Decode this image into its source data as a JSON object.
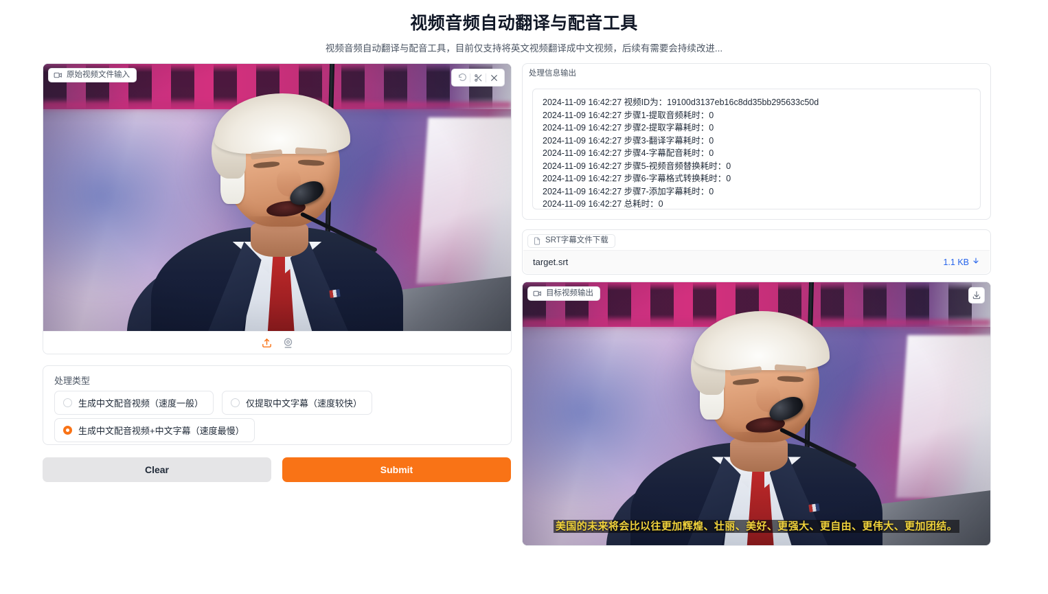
{
  "header": {
    "title": "视频音频自动翻译与配音工具",
    "subtitle": "视频音频自动翻译与配音工具，目前仅支持将英文视频翻译成中文视频，后续有需要会持续改进..."
  },
  "video_input": {
    "label": "原始视频文件输入",
    "icons": {
      "block": "video-camera-icon",
      "undo": "undo-icon",
      "trim": "scissors-icon",
      "close": "close-icon",
      "upload": "upload-icon",
      "webcam": "webcam-icon"
    }
  },
  "process_type": {
    "label": "处理类型",
    "options": [
      {
        "label": "生成中文配音视频（速度一般）",
        "selected": false
      },
      {
        "label": "仅提取中文字幕（速度较快）",
        "selected": false
      },
      {
        "label": "生成中文配音视频+中文字幕（速度最慢）",
        "selected": true
      }
    ]
  },
  "actions": {
    "clear_label": "Clear",
    "submit_label": "Submit"
  },
  "log_panel": {
    "label": "处理信息输出",
    "lines": [
      "2024-11-09 16:42:27 视频ID为：19100d3137eb16c8dd35bb295633c50d",
      "2024-11-09 16:42:27 步骤1-提取音频耗时：0",
      "2024-11-09 16:42:27 步骤2-提取字幕耗时：0",
      "2024-11-09 16:42:27 步骤3-翻译字幕耗时：0",
      "2024-11-09 16:42:27 步骤4-字幕配音耗时：0",
      "2024-11-09 16:42:27 步骤5-视频音频替换耗时：0",
      "2024-11-09 16:42:27 步骤6-字幕格式转换耗时：0",
      "2024-11-09 16:42:27 步骤7-添加字幕耗时：0",
      "2024-11-09 16:42:27 总耗时：0"
    ]
  },
  "srt_download": {
    "label": "SRT字幕文件下载",
    "file_name": "target.srt",
    "file_size": "1.1 KB",
    "icons": {
      "file": "file-icon",
      "download": "download-arrow-icon"
    }
  },
  "video_output": {
    "label": "目标视频输出",
    "subtitle_text": "美国的未来将会比以往更加辉煌、壮丽、美好、更强大、更自由、更伟大、更加团结。",
    "icons": {
      "block": "video-camera-icon",
      "download": "download-icon"
    }
  },
  "colors": {
    "accent": "#f97316",
    "link": "#2563eb",
    "clear_button_bg": "#e5e5e7",
    "subtitle_text": "#f0d23c",
    "page_bg": "#ffffff",
    "border": "#e5e7eb"
  }
}
